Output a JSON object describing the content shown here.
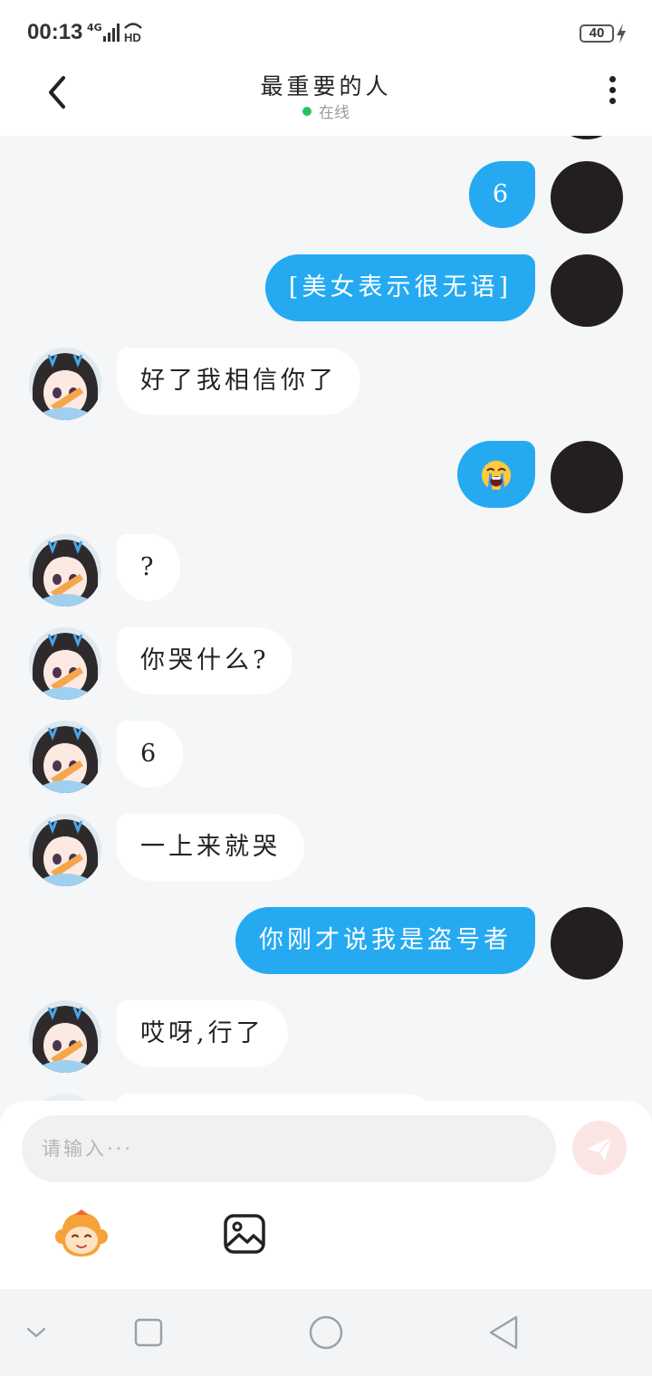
{
  "status_bar": {
    "time": "00:13",
    "network": "4G",
    "hd": "HD",
    "battery": "40"
  },
  "header": {
    "title": "最重要的人",
    "status": "在线"
  },
  "messages": [
    {
      "side": "out",
      "text": "6"
    },
    {
      "side": "out",
      "text": "[美女表示很无语]"
    },
    {
      "side": "in",
      "text": "好了我相信你了"
    },
    {
      "side": "out",
      "text": "😭"
    },
    {
      "side": "in",
      "text": "?"
    },
    {
      "side": "in",
      "text": "你哭什么?"
    },
    {
      "side": "in",
      "text": "6"
    },
    {
      "side": "in",
      "text": "一上来就哭"
    },
    {
      "side": "out",
      "text": "你刚才说我是盗号者"
    },
    {
      "side": "in",
      "text": "哎呀,行了"
    }
  ],
  "input": {
    "placeholder": "请输入···"
  },
  "colors": {
    "outgoing_bubble": "#25aaf2",
    "incoming_bubble": "#ffffff",
    "online_dot": "#22c55e",
    "background": "#f4f6f7"
  },
  "icons": {
    "back": "chevron-left-icon",
    "more": "more-vertical-icon",
    "send": "send-icon",
    "emoji": "monkey-emoji-icon",
    "image": "image-icon",
    "nav": [
      "collapse-icon",
      "recent-apps-icon",
      "home-icon",
      "nav-back-icon"
    ]
  }
}
